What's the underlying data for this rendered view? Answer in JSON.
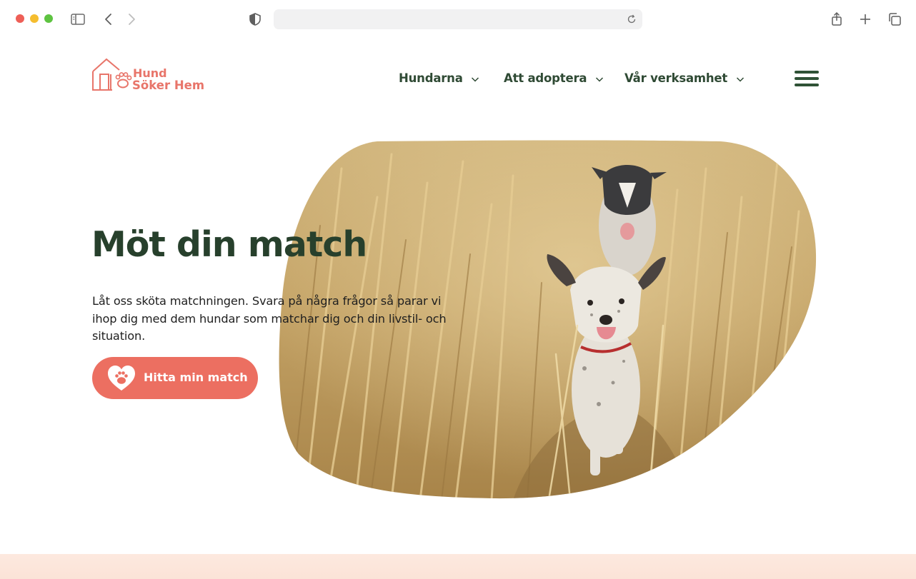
{
  "browser": {
    "icons": [
      "sidebar-icon",
      "back-icon",
      "forward-icon",
      "shield-icon",
      "reload-icon",
      "share-icon",
      "new-tab-icon",
      "tabs-icon"
    ]
  },
  "site": {
    "logo": {
      "line1": "Hund",
      "line2": "Söker Hem"
    },
    "nav": [
      {
        "label": "Hundarna"
      },
      {
        "label": "Att adoptera"
      },
      {
        "label": "Vår verksamhet"
      }
    ]
  },
  "hero": {
    "title": "Möt din match",
    "text": "Låt oss sköta matchningen. Svara på några frågor så parar vi ihop dig med dem hundar som matchar dig och din livstil- och situation.",
    "cta_label": "Hitta min match"
  },
  "colors": {
    "brand": "#e8756a",
    "cta": "#ec6f61",
    "nav_text": "#2f4a34",
    "title": "#27402c"
  }
}
